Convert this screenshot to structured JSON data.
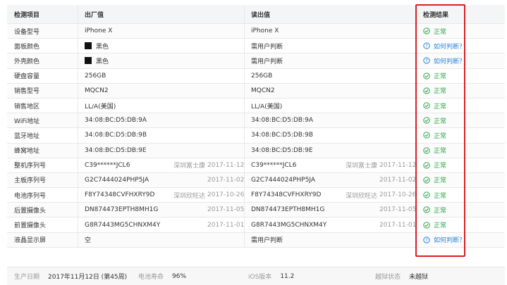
{
  "table": {
    "headers": {
      "item": "检测项目",
      "factory": "出厂值",
      "read": "读出值",
      "result": "检测结果"
    },
    "rows": [
      {
        "item": "设备型号",
        "factory": "iPhone X",
        "read": "iPhone X",
        "result": "正常",
        "status": "ok"
      },
      {
        "item": "面板颜色",
        "factory": "黑色",
        "swatch": true,
        "read": "需用户判断",
        "result": "如何判断？",
        "status": "question"
      },
      {
        "item": "外壳颜色",
        "factory": "黑色",
        "swatch": true,
        "read": "需用户判断",
        "result": "如何判断？",
        "status": "question"
      },
      {
        "item": "硬盘容量",
        "factory": "256GB",
        "read": "256GB",
        "result": "正常",
        "status": "ok"
      },
      {
        "item": "销售型号",
        "factory": "MQCN2",
        "read": "MQCN2",
        "result": "正常",
        "status": "ok"
      },
      {
        "item": "销售地区",
        "factory": "LL/A(美国)",
        "read": "LL/A(美国)",
        "result": "正常",
        "status": "ok"
      },
      {
        "item": "WiFi地址",
        "factory": "34:08:BC:D5:DB:9A",
        "read": "34:08:BC:D5:DB:9A",
        "result": "正常",
        "status": "ok"
      },
      {
        "item": "蓝牙地址",
        "factory": "34:08:BC:D5:DB:9B",
        "read": "34:08:BC:D5:DB:9B",
        "result": "正常",
        "status": "ok"
      },
      {
        "item": "蜂窝地址",
        "factory": "34:08:BC:D5:DB:9E",
        "read": "34:08:BC:D5:DB:9E",
        "result": "正常",
        "status": "ok"
      },
      {
        "item": "整机序列号",
        "factory": "C39******JCL6",
        "factory_src": "深圳富士康",
        "factory_date": "2017-11-12",
        "read": "C39******JCL6",
        "read_src": "深圳富士康",
        "read_date": "2017-11-12",
        "result": "正常",
        "status": "ok"
      },
      {
        "item": "主板序列号",
        "factory": "G2C7444024PHP5JA",
        "factory_date": "2017-11-02",
        "read": "G2C7444024PHP5JA",
        "read_date": "2017-11-02",
        "result": "正常",
        "status": "ok"
      },
      {
        "item": "电池序列号",
        "factory": "F8Y74348CVFHXRY9D",
        "factory_src": "深圳欣旺达",
        "factory_date": "2017-10-26",
        "read": "F8Y74348CVFHXRY9D",
        "read_src": "深圳欣旺达",
        "read_date": "2017-10-26",
        "result": "正常",
        "status": "ok"
      },
      {
        "item": "后置摄像头",
        "factory": "DN874473EPTH8MH1G",
        "factory_date": "2017-11-05",
        "read": "DN874473EPTH8MH1G",
        "read_date": "2017-11-05",
        "result": "正常",
        "status": "ok"
      },
      {
        "item": "前置摄像头",
        "factory": "G8R7443MG5CHNXM4Y",
        "factory_date": "2017-11-01",
        "read": "G8R7443MG5CHNXM4Y",
        "read_date": "2017-11-01",
        "result": "正常",
        "status": "ok"
      },
      {
        "item": "液晶显示屏",
        "factory": "空",
        "read": "需用户判断",
        "result": "如何判断？",
        "status": "question"
      }
    ]
  },
  "footer": {
    "items": [
      {
        "label": "生产日期",
        "value": "2017年11月12日 (第45周)"
      },
      {
        "label": "电池寿命",
        "value": "96%"
      },
      {
        "label": "iOS版本",
        "value": "11.2"
      },
      {
        "label": "越狱状态",
        "value": "未越狱"
      }
    ]
  },
  "colors": {
    "ok": "#2fa54a",
    "question": "#2b86d9",
    "highlight": "#d71f22"
  },
  "icons": {
    "ok": "check-circle-icon",
    "question": "question-circle-icon"
  }
}
